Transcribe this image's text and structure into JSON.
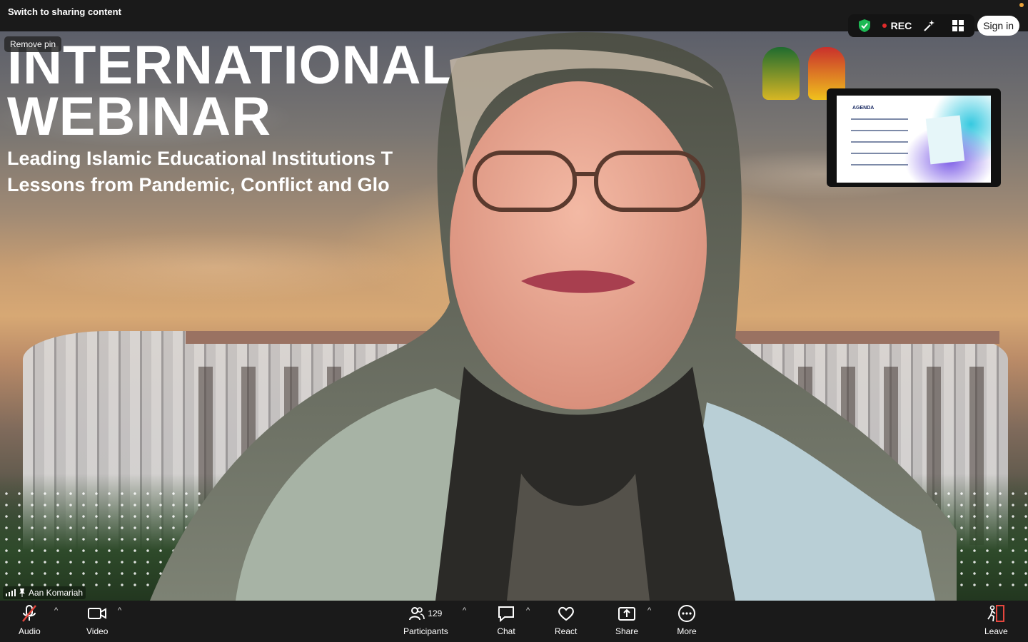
{
  "topbar": {
    "switch_label": "Switch to sharing content"
  },
  "stage": {
    "remove_pin_label": "Remove pin",
    "webinar_title_line1": "INTERNATIONAL",
    "webinar_title_line2": "WEBINAR",
    "subtitle_line1": "Leading Islamic Educational Institutions T",
    "subtitle_line2": "Lessons from Pandemic, Conflict and Glo",
    "speaker_name": "Aan Komariah"
  },
  "top_right": {
    "rec_label": "REC",
    "signin_label": "Sign in",
    "shield_color": "#1db954"
  },
  "thumbnail": {
    "slide_title": "AGENDA"
  },
  "toolbar": {
    "audio_label": "Audio",
    "video_label": "Video",
    "participants_label": "Participants",
    "participants_count": "129",
    "chat_label": "Chat",
    "react_label": "React",
    "share_label": "Share",
    "more_label": "More",
    "leave_label": "Leave"
  },
  "colors": {
    "leave_red": "#e5463d",
    "mute_red": "#e5463d"
  }
}
